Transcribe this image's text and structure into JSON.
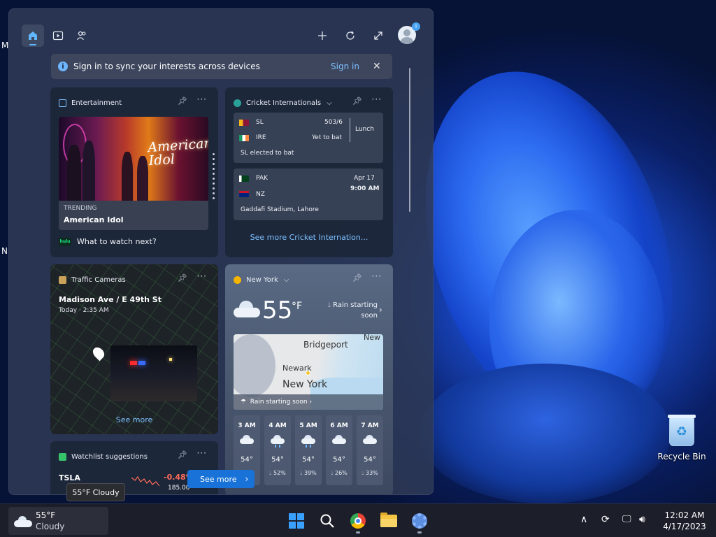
{
  "desktop": {
    "edge_letters": [
      "M",
      "N"
    ],
    "recycle_bin_label": "Recycle Bin"
  },
  "widgets": {
    "toolbar": {
      "icons": [
        "home-icon",
        "play-icon",
        "people-icon",
        "plus-icon",
        "refresh-icon",
        "expand-icon"
      ],
      "avatar_badge": "i"
    },
    "banner": {
      "text": "Sign in to sync your interests across devices",
      "sign_in": "Sign in"
    },
    "entertainment": {
      "title": "Entertainment",
      "image_text": "American Idol",
      "trending_label": "TRENDING",
      "trending_title": "American Idol",
      "provider": "hulu",
      "watch_next": "What to watch next?"
    },
    "cricket": {
      "title": "Cricket Internationals",
      "match1": {
        "team1": "SL",
        "score1": "503/6",
        "team2": "IRE",
        "score2": "Yet to bat",
        "status": "Lunch",
        "note": "SL elected to bat"
      },
      "match2": {
        "team1": "PAK",
        "team2": "NZ",
        "date": "Apr 17",
        "time": "9:00 AM",
        "venue": "Gaddafi Stadium, Lahore"
      },
      "see_more": "See more Cricket Internation..."
    },
    "traffic": {
      "title": "Traffic Cameras",
      "location": "Madison Ave / E 49th St",
      "time": "Today · 2:35 AM",
      "see_more": "See more"
    },
    "weather": {
      "location": "New York",
      "temp": "55",
      "unit": "°F",
      "summary_line1": "Rain starting",
      "summary_line2": "soon",
      "map_labels": [
        "Bridgeport",
        "New",
        "Newark",
        "New York"
      ],
      "map_caption": "Rain starting soon",
      "hourly": [
        {
          "hour": "3 AM",
          "temp": "54°",
          "precip": "",
          "icon": "cloud-icon"
        },
        {
          "hour": "4 AM",
          "temp": "54°",
          "precip": "52%",
          "icon": "rain-cloud-icon"
        },
        {
          "hour": "5 AM",
          "temp": "54°",
          "precip": "39%",
          "icon": "rain-cloud-icon"
        },
        {
          "hour": "6 AM",
          "temp": "54°",
          "precip": "26%",
          "icon": "cloud-icon"
        },
        {
          "hour": "7 AM",
          "temp": "54°",
          "precip": "33%",
          "icon": "cloud-icon"
        }
      ]
    },
    "watchlist": {
      "title": "Watchlist suggestions",
      "ticker": "TSLA",
      "change": "-0.48%",
      "price": "185.00"
    },
    "see_more_button": "See more",
    "tooltip": "55°F Cloudy"
  },
  "taskbar": {
    "weather_temp": "55°F",
    "weather_cond": "Cloudy",
    "apps": [
      "windows-start-icon",
      "search-icon",
      "chrome-icon",
      "file-explorer-icon",
      "settings-icon"
    ],
    "clock_time": "12:02 AM",
    "clock_date": "4/17/2023"
  },
  "colors": {
    "accent": "#1872d8",
    "link": "#7cc0ff",
    "negative": "#ff6b5a"
  }
}
